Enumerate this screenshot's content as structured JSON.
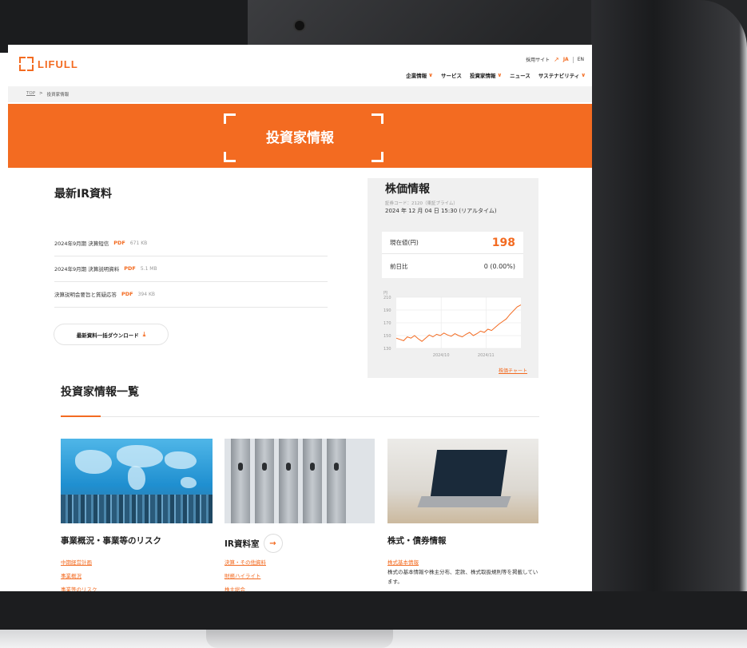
{
  "header": {
    "logo_text": "LIFULL",
    "recruit_link": "採用サイト",
    "lang_ja": "JA",
    "lang_en": "EN",
    "nav": [
      "企業情報",
      "サービス",
      "投資家情報",
      "ニュース",
      "サステナビリティ"
    ]
  },
  "breadcrumb": {
    "top": "TOP",
    "separator": ">",
    "current": "投資家情報"
  },
  "hero": {
    "title": "投資家情報"
  },
  "latest_ir": {
    "title": "最新IR資料",
    "items": [
      {
        "name": "2024年9月期 決算短信",
        "type": "PDF",
        "size": "671 KB"
      },
      {
        "name": "2024年9月期 決算説明資料",
        "type": "PDF",
        "size": "5.1 MB"
      },
      {
        "name": "決算説明会要旨と質疑応答",
        "type": "PDF",
        "size": "394 KB"
      }
    ],
    "download_button": "最新資料一括ダウンロード"
  },
  "stock": {
    "title": "株価情報",
    "code": "証券コード：2120（東証プライム）",
    "time": "2024 年 12 月 04 日 15:30 (リアルタイム)",
    "current_label": "現在値(円)",
    "current_value": "198",
    "diff_label": "前日比",
    "diff_value": "0 (0.00%)",
    "chart_link": "株価チャート"
  },
  "chart_data": {
    "type": "line",
    "ylabel": "円",
    "ylim": [
      130,
      210
    ],
    "yticks": [
      210,
      190,
      170,
      150,
      130
    ],
    "xticks": [
      "2024/10",
      "2024/11"
    ],
    "series": [
      {
        "values": [
          146,
          144,
          142,
          148,
          146,
          150,
          145,
          141,
          146,
          151,
          148,
          152,
          150,
          154,
          151,
          149,
          153,
          150,
          148,
          152,
          155,
          150,
          153,
          157,
          155,
          160,
          158,
          163,
          168,
          172,
          176,
          183,
          189,
          195,
          198
        ]
      }
    ]
  },
  "ir_list": {
    "title": "投資家情報一覧",
    "cards": [
      {
        "title": "事業概況・事業等のリスク",
        "links": [
          "中期経営計画",
          "事業概況",
          "事業等のリスク"
        ]
      },
      {
        "title": "IR資料室",
        "links": [
          "決算・その他資料",
          "財務ハイライト",
          "株主総会"
        ]
      },
      {
        "title": "株式・債券情報",
        "links": [
          "株式基本情報"
        ],
        "desc": "株式の基本情報や株主分布、定款、株式取扱規則等を掲載しています。"
      }
    ]
  },
  "colors": {
    "accent": "#f36b21"
  }
}
